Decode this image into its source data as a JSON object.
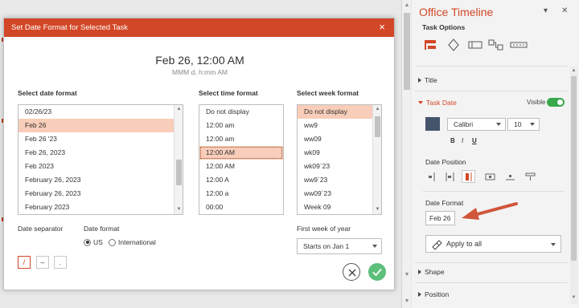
{
  "dialog": {
    "title": "Set Date Format for Selected Task",
    "preview": "Feb 26, 12:00 AM",
    "preview_pattern": "MMM d, h:mm AM",
    "date_list_label": "Select date format",
    "date_formats": [
      "02/26/23",
      "Feb 26",
      "Feb 26 '23",
      "Feb 26, 2023",
      "Feb 2023",
      "February 26, 2023",
      "February 26, 2023",
      "February 2023"
    ],
    "date_selected_index": 1,
    "time_list_label": "Select time format",
    "time_formats": [
      "Do not display",
      "12:00 am",
      "12:00 am",
      "12:00 AM",
      "12:00 AM",
      "12:00 A",
      "12:00 a",
      "00:00"
    ],
    "time_selected_index": 3,
    "week_list_label": "Select week format",
    "week_formats": [
      "Do not display",
      "ww9",
      "ww09",
      "wk09",
      "wk09`23",
      "ww9`23",
      "ww09`23",
      "Week 09"
    ],
    "week_selected_index": 0,
    "separator_label": "Date separator",
    "separators": [
      "/",
      "–",
      "."
    ],
    "date_format_label": "Date format",
    "radio_us": "US",
    "radio_international": "International",
    "first_week_label": "First week of year",
    "first_week_value": "Starts on Jan 1",
    "close_glyph": "×"
  },
  "pane": {
    "title": "Office Timeline",
    "subtitle": "Task Options",
    "section_title": "Title",
    "section_task_date": "Task Date",
    "visible_label": "Visible",
    "visible_on": true,
    "date_color": "#44546a",
    "font_name": "Calibri",
    "font_size": "10",
    "bold_label": "B",
    "italic_label": "I",
    "underline_label": "U",
    "date_position_label": "Date Position",
    "date_format_label": "Date Format",
    "date_format_value": "Feb 26",
    "apply_label": "Apply to all",
    "section_shape": "Shape",
    "section_position": "Position"
  },
  "colors": {
    "accent": "#d24727",
    "selection": "#f8cdb9",
    "toggle_on": "#38a84b",
    "ok_green": "#5cbf7a",
    "arrow": "#d0553a"
  }
}
